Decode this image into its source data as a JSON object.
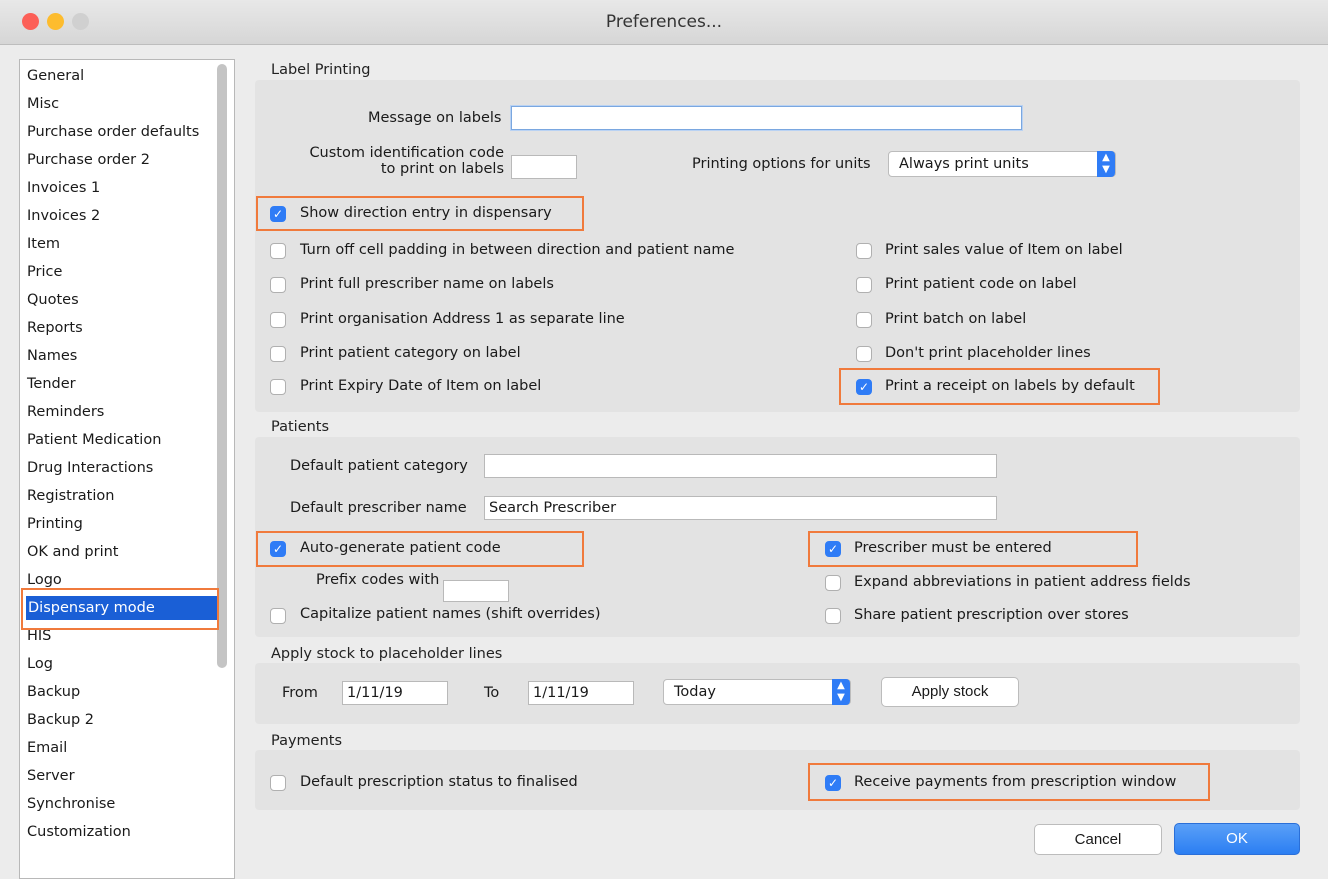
{
  "window": {
    "title": "Preferences..."
  },
  "colors": {
    "accent": "#2f7cf6",
    "highlight": "#f07a3c",
    "selection": "#1a5fd6"
  },
  "sidebar": {
    "items": [
      "General",
      "Misc",
      "Purchase order defaults",
      "Purchase order 2",
      "Invoices 1",
      "Invoices 2",
      "Item",
      "Price",
      "Quotes",
      "Reports",
      "Names",
      "Tender",
      "Reminders",
      "Patient Medication",
      "Drug Interactions",
      "Registration",
      "Printing",
      "OK and print",
      "Logo",
      "Dispensary mode",
      "HIS",
      "Log",
      "Backup",
      "Backup 2",
      "Email",
      "Server",
      "Synchronise",
      "Customization"
    ],
    "selected": "Dispensary mode"
  },
  "label_printing": {
    "title": "Label Printing",
    "message_label": "Message on labels",
    "message_value": "",
    "custom_code_label_1": "Custom identification code",
    "custom_code_label_2": "to print on labels",
    "custom_code_value": "",
    "units_label": "Printing options for units",
    "units_value": "Always print units",
    "show_direction": {
      "label": "Show direction entry in dispensary",
      "checked": true
    },
    "left_options": [
      {
        "label": "Turn off cell padding in between direction and patient name",
        "checked": false
      },
      {
        "label": "Print full prescriber name on labels",
        "checked": false
      },
      {
        "label": "Print organisation Address 1 as separate line",
        "checked": false
      },
      {
        "label": "Print patient category on label",
        "checked": false
      },
      {
        "label": "Print Expiry Date of Item on label",
        "checked": false
      }
    ],
    "right_options": [
      {
        "label": "Print sales value of Item on label",
        "checked": false
      },
      {
        "label": "Print patient code on label",
        "checked": false
      },
      {
        "label": "Print batch on label",
        "checked": false
      },
      {
        "label": "Don't print placeholder lines",
        "checked": false
      },
      {
        "label": "Print a receipt on labels by default",
        "checked": true
      }
    ]
  },
  "patients": {
    "title": "Patients",
    "category_label": "Default patient category",
    "category_value": "",
    "prescriber_label": "Default prescriber name",
    "prescriber_value": "Search Prescriber",
    "auto_generate": {
      "label": "Auto-generate patient code",
      "checked": true
    },
    "prefix_label": "Prefix codes with",
    "prefix_value": "",
    "capitalize": {
      "label": "Capitalize patient names (shift overrides)",
      "checked": false
    },
    "prescriber_required": {
      "label": "Prescriber must be entered",
      "checked": true
    },
    "expand_abbrev": {
      "label": "Expand abbreviations in patient address fields",
      "checked": false
    },
    "share_prescription": {
      "label": "Share patient prescription over stores",
      "checked": false
    }
  },
  "apply_stock": {
    "title": "Apply stock to placeholder lines",
    "from_label": "From",
    "from_value": "1/11/19",
    "to_label": "To",
    "to_value": "1/11/19",
    "range_value": "Today",
    "apply_button": "Apply stock"
  },
  "payments": {
    "title": "Payments",
    "default_finalised": {
      "label": "Default prescription status to finalised",
      "checked": false
    },
    "receive_payments": {
      "label": "Receive payments from prescription window",
      "checked": true
    }
  },
  "footer": {
    "cancel": "Cancel",
    "ok": "OK"
  }
}
